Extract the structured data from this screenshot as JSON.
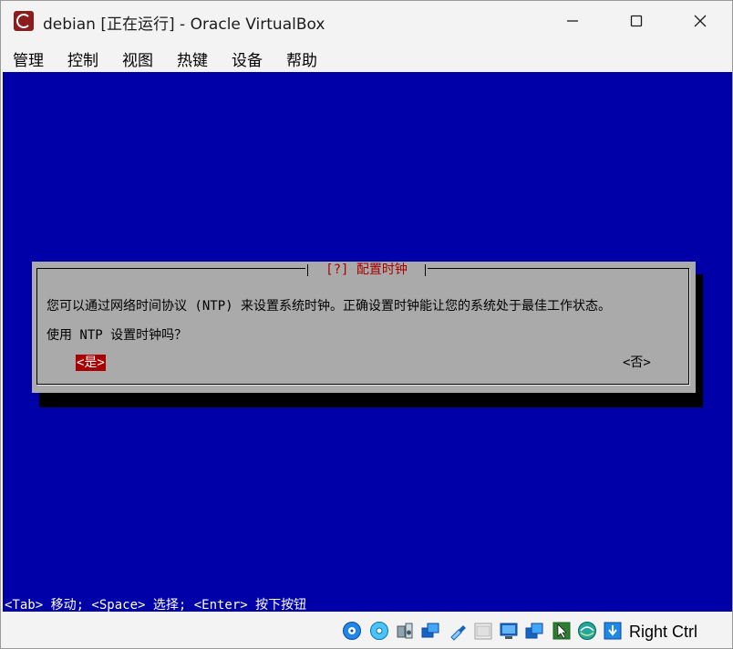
{
  "window": {
    "title": "debian [正在运行] - Oracle VirtualBox",
    "app_icon": "virtualbox-vm-icon",
    "controls": [
      "minimize-icon",
      "maximize-icon",
      "close-icon"
    ]
  },
  "menubar": {
    "items": [
      {
        "label": "管理"
      },
      {
        "label": "控制"
      },
      {
        "label": "视图"
      },
      {
        "label": "热键"
      },
      {
        "label": "设备"
      },
      {
        "label": "帮助"
      }
    ]
  },
  "dialog": {
    "title": "[?] 配置时钟",
    "line1": "您可以通过网络时间协议 (NTP) 来设置系统时钟。正确设置时钟能让您的系统处于最佳工作状态。",
    "line2": "使用 NTP 设置时钟吗？",
    "yes_label": "<是>",
    "no_label": "<否>"
  },
  "help_line": "<Tab> 移动; <Space> 选择; <Enter> 按下按钮",
  "statusbar": {
    "icons": [
      "hard-disk-icon",
      "optical-drive-icon",
      "audio-icon",
      "network-icon",
      "usb-icon",
      "shared-folder-icon",
      "display-icon",
      "recording-icon",
      "mouse-integration-icon",
      "cpu-activity-icon",
      "keyboard-capture-icon"
    ],
    "host_key": "Right Ctrl"
  },
  "colors": {
    "vm_background": "#0000a8",
    "dialog_background": "#aaaaaa",
    "dialog_title": "#a80000",
    "selected_button": "#a80000"
  }
}
